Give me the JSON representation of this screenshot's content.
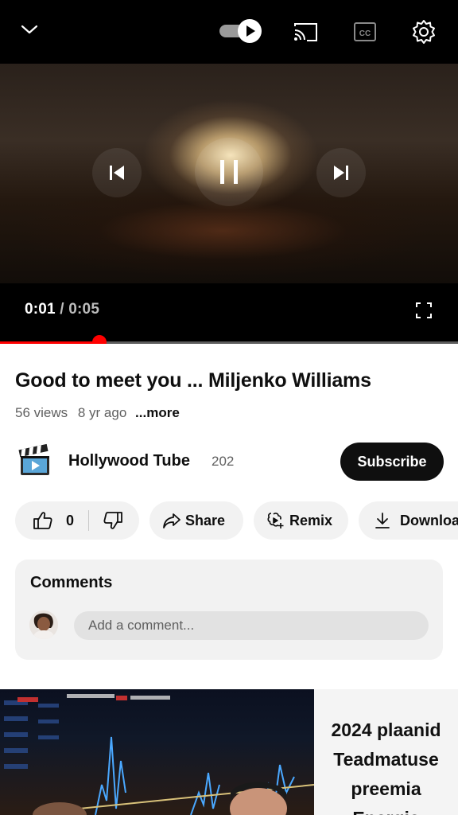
{
  "player": {
    "current_time": "0:01",
    "separator": " / ",
    "duration": "0:05",
    "progress_fraction": 0.217,
    "autoplay_on": true,
    "icons": {
      "collapse": "chevron-down-icon",
      "autoplay": "autoplay-toggle-icon",
      "cast": "cast-icon",
      "captions": "closed-captions-icon",
      "settings": "gear-icon",
      "previous": "skip-previous-icon",
      "play_pause": "pause-icon",
      "next": "skip-next-icon",
      "fullscreen": "fullscreen-icon"
    },
    "progress_color": "#ff0000"
  },
  "video": {
    "title": "Good to meet you ... Miljenko Williams",
    "views": "56 views",
    "age": "8 yr ago",
    "more_label": "...more"
  },
  "channel": {
    "name": "Hollywood Tube",
    "subscriber_count": "202",
    "avatar_icon": "clapperboard-icon",
    "subscribe_label": "Subscribe"
  },
  "actions": {
    "like_count": "0",
    "share_label": "Share",
    "remix_label": "Remix",
    "download_label": "Downloa"
  },
  "comments": {
    "title": "Comments",
    "placeholder": "Add a comment..."
  },
  "next_video": {
    "thumbnail_lines": [
      "2024 plaanid",
      "Teadmatuse",
      "preemia",
      "Energia"
    ]
  }
}
